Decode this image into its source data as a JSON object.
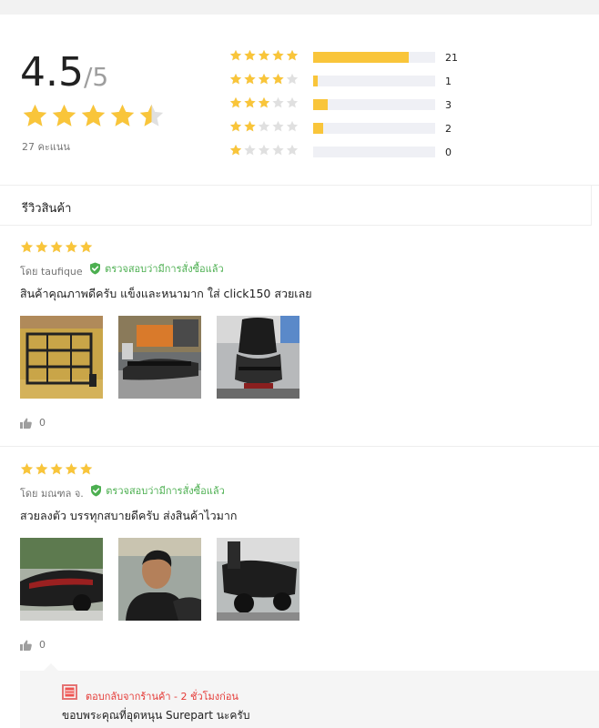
{
  "summary": {
    "score": "4.5",
    "out_of": "/5",
    "rating_value": 4.5,
    "count_label": "27 คะแนน",
    "distribution": [
      {
        "stars": 5,
        "count": "21",
        "fill": 0.78
      },
      {
        "stars": 4,
        "count": "1",
        "fill": 0.04
      },
      {
        "stars": 3,
        "count": "3",
        "fill": 0.12
      },
      {
        "stars": 2,
        "count": "2",
        "fill": 0.08
      },
      {
        "stars": 1,
        "count": "0",
        "fill": 0.0
      }
    ]
  },
  "section_title": "รีวิวสินค้า",
  "reviews": [
    {
      "stars": 5,
      "author": "โดย taufique",
      "verified": "ตรวจสอบว่ามีการสั่งซื้อแล้ว",
      "text": "สินค้าคุณภาพดีครับ แข็งและหนามาก ใส่ click150 สวยเลย",
      "likes": "0",
      "images": [
        "rack-photo",
        "motorbike-rack-photo",
        "motorbike-rear-photo"
      ]
    },
    {
      "stars": 5,
      "author": "โดย มณฑล จ.",
      "verified": "ตรวจสอบว่ามีการสั่งซื้อแล้ว",
      "text": "สวยลงตัว บรรทุกสบายดีครับ ส่งสินค้าไวมาก",
      "likes": "0",
      "images": [
        "motorbike-side-photo",
        "customer-photo",
        "motorbike-parked-photo"
      ],
      "reply": {
        "meta": "ตอบกลับจากร้านค้า - 2 ชั่วโมงก่อน",
        "text": "ขอบพระคุณที่อุดหนุน Surepart นะครับ"
      }
    }
  ],
  "colors": {
    "star": "#f9c53a",
    "star_empty": "#e0e0e0",
    "verified": "#4caf50",
    "reply_accent": "#e53935"
  },
  "icons": {
    "verified": "shield-check-icon",
    "like": "thumbs-up-icon",
    "shop": "shop-icon"
  }
}
